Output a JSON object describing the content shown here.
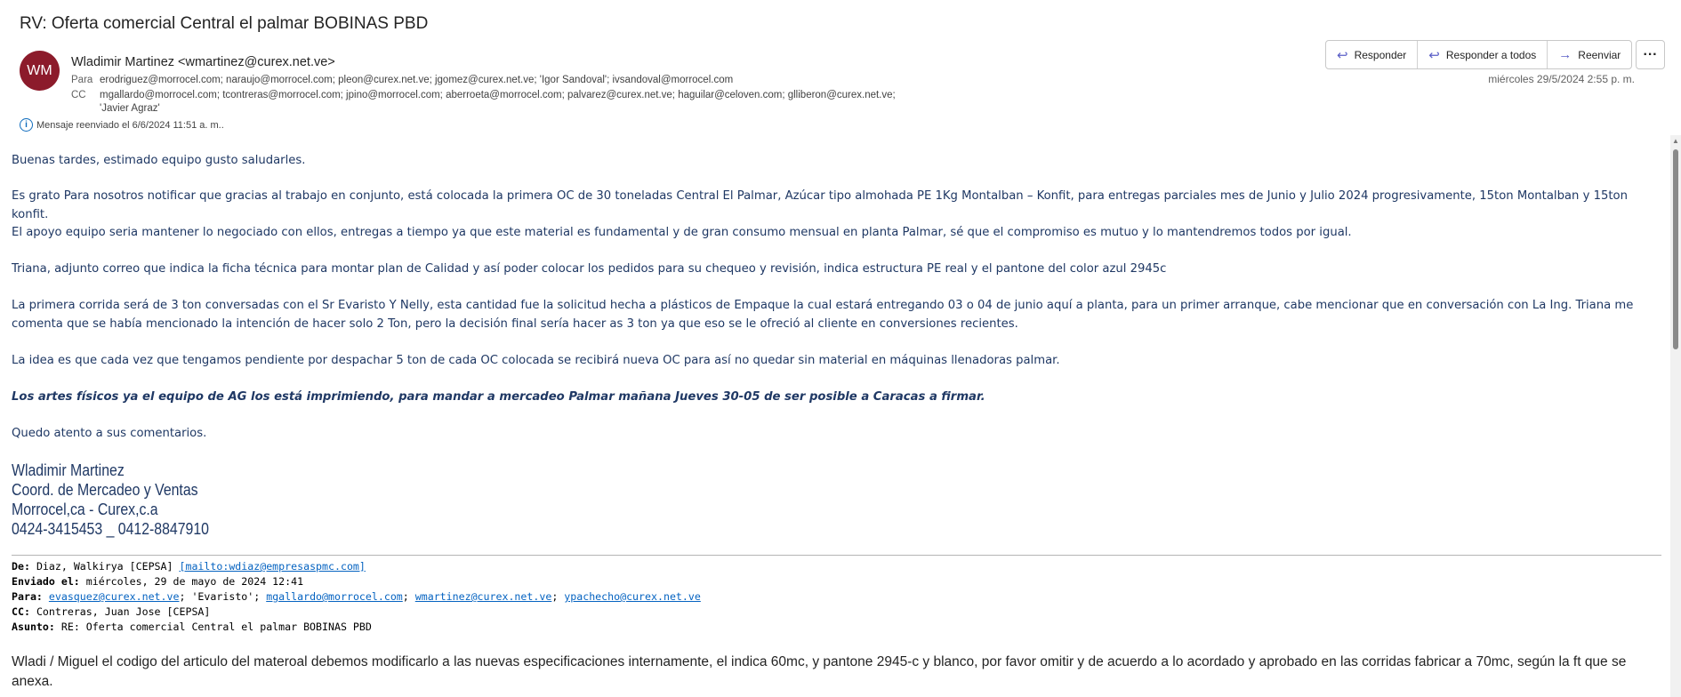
{
  "subject": "RV: Oferta comercial Central el palmar BOBINAS PBD",
  "avatar_initials": "WM",
  "sender": "Wladimir Martinez <wmartinez@curex.net.ve>",
  "to_label": "Para",
  "to": "erodriguez@morrocel.com; naraujo@morrocel.com; pleon@curex.net.ve; jgomez@curex.net.ve; 'Igor Sandoval'; ivsandoval@morrocel.com",
  "cc_label": "CC",
  "cc_line1": "mgallardo@morrocel.com; tcontreras@morrocel.com; jpino@morrocel.com; aberroeta@morrocel.com; palvarez@curex.net.ve; haguilar@celoven.com; glliberon@curex.net.ve;",
  "cc_line2": "'Javier Agraz'",
  "forwarded_note": "Mensaje reenviado el 6/6/2024 11:51 a. m..",
  "actions": {
    "reply": "Responder",
    "reply_all": "Responder a todos",
    "forward": "Reenviar"
  },
  "date": "miércoles 29/5/2024 2:55 p. m.",
  "body": {
    "p1": "Buenas tardes, estimado equipo gusto saludarles.",
    "p2": "Es grato Para nosotros  notificar que gracias al trabajo en conjunto, está colocada la primera OC de 30 toneladas Central El Palmar,  Azúcar tipo almohada PE 1Kg Montalban – Konfit, para entregas parciales mes de Junio y Julio 2024 progresivamente, 15ton Montalban y 15ton konfit.",
    "p3": "El apoyo equipo seria mantener  lo negociado con ellos, entregas a tiempo ya que este material es fundamental y de gran consumo mensual en planta Palmar,  sé que el compromiso es mutuo y lo mantendremos todos por igual.",
    "p4": "Triana, adjunto correo que indica la ficha técnica para montar plan de Calidad y así poder colocar los pedidos para su chequeo y revisión, indica estructura PE real y el pantone del color azul 2945c",
    "p5": "La primera corrida será de 3 ton conversadas con el Sr Evaristo Y Nelly, esta cantidad fue la solicitud hecha a plásticos de Empaque la cual estará entregando 03 o 04 de junio aquí a planta, para un primer arranque,  cabe mencionar que en conversación con La Ing. Triana me comenta que se había mencionado la intención de hacer solo 2 Ton, pero la decisión final sería hacer as 3 ton ya que eso se le ofreció al cliente en conversiones recientes.",
    "p6": "La idea es que cada vez que tengamos pendiente por despachar 5 ton de cada OC colocada se recibirá nueva OC para así no quedar sin material en máquinas llenadoras palmar.",
    "p7": "Los artes físicos ya el equipo de AG los está imprimiendo, para mandar a mercadeo Palmar mañana Jueves 30-05 de ser posible a Caracas a firmar.",
    "p8": "Quedo atento a sus comentarios."
  },
  "signature": {
    "name": "Wladimir Martinez",
    "title": "Coord. de Mercadeo y Ventas",
    "company": "Morrocel,ca - Curex,c.a",
    "phones": "0424-3415453 _ 0412-8847910"
  },
  "quoted": {
    "from_label": "De:",
    "from": "Diaz, Walkirya [CEPSA]",
    "from_link": "[mailto:wdiaz@empresaspmc.com]",
    "sent_label": "Enviado el:",
    "sent": "miércoles, 29 de mayo de 2024 12:41",
    "to_label": "Para:",
    "to_1": "evasquez@curex.net.ve",
    "to_2": "'Evaristo';",
    "to_3": "mgallardo@morrocel.com",
    "to_4": "wmartinez@curex.net.ve",
    "to_5": "ypachecho@curex.net.ve",
    "cc_label": "CC:",
    "cc": "Contreras, Juan Jose [CEPSA]",
    "subject_label": "Asunto:",
    "subject": "RE: Oferta comercial Central el palmar BOBINAS PBD",
    "text": "Wladi / Miguel el codigo del articulo del materoal debemos modificarlo a las nuevas especificaciones internamente, el indica 60mc, y pantone 2945-c y blanco, por favor omitir y de acuerdo a lo acordado y aprobado en las corridas fabricar a 70mc, según la ft que se anexa."
  }
}
